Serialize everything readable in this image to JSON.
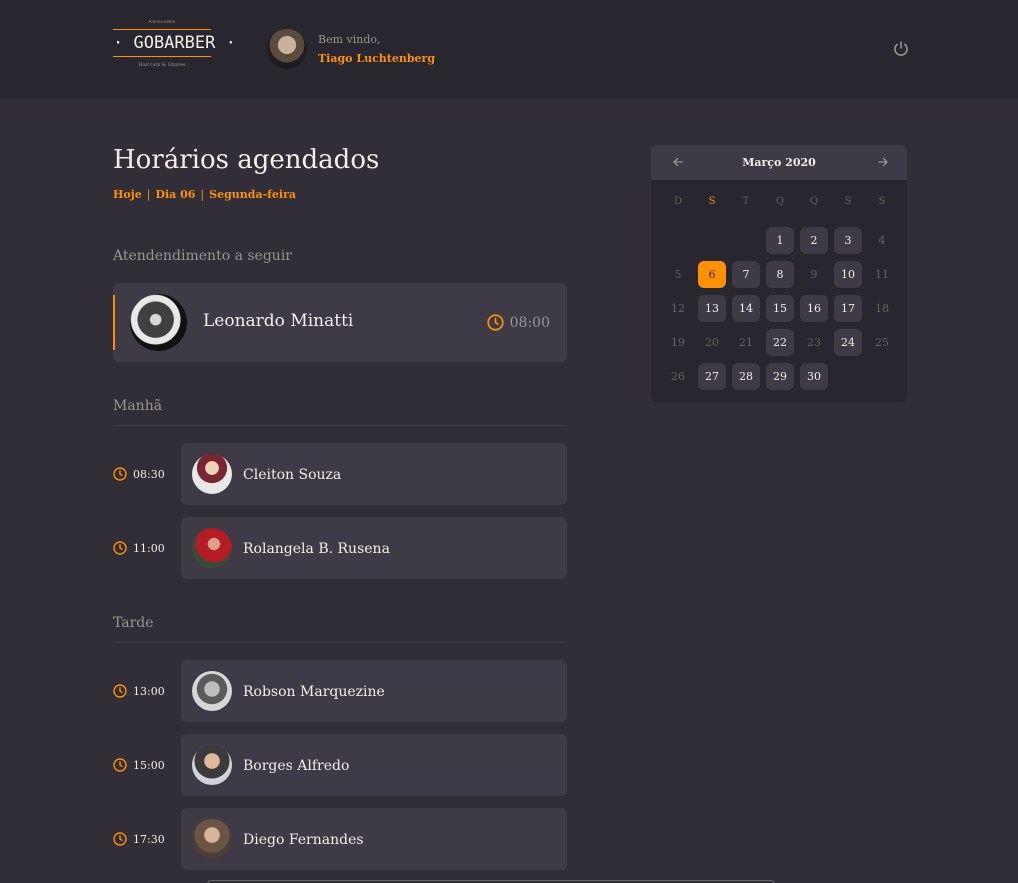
{
  "header": {
    "logo": {
      "top_text": "Awesome",
      "mark": "· GOBARBER ·",
      "bottom_text": "Haircuts & Shaves"
    },
    "welcome": "Bem vindo,",
    "user_name": "Tiago Luchtenberg",
    "power_icon": "power-icon"
  },
  "schedule": {
    "title": "Horários agendados",
    "subtitle": {
      "today": "Hoje",
      "sep": "|",
      "day": "Dia 06",
      "weekday": "Segunda-feira"
    },
    "next": {
      "label": "Atendendimento a seguir",
      "name": "Leonardo Minatti",
      "time": "08:00"
    },
    "morning": {
      "label": "Manhã",
      "items": [
        {
          "time": "08:30",
          "name": "Cleiton Souza"
        },
        {
          "time": "11:00",
          "name": "Rolangela B. Rusena"
        }
      ]
    },
    "afternoon": {
      "label": "Tarde",
      "items": [
        {
          "time": "13:00",
          "name": "Robson Marquezine"
        },
        {
          "time": "15:00",
          "name": "Borges Alfredo"
        },
        {
          "time": "17:30",
          "name": "Diego Fernandes"
        }
      ]
    }
  },
  "calendar": {
    "month_label": "Março 2020",
    "weekdays": [
      "D",
      "S",
      "T",
      "Q",
      "Q",
      "S",
      "S"
    ],
    "active_weekday_index": 1,
    "selected_day": 6,
    "weeks": [
      [
        null,
        null,
        null,
        1,
        2,
        3,
        4
      ],
      [
        5,
        6,
        7,
        8,
        9,
        10,
        11
      ],
      [
        12,
        13,
        14,
        15,
        16,
        17,
        18
      ],
      [
        19,
        20,
        21,
        22,
        23,
        24,
        25
      ],
      [
        26,
        27,
        28,
        29,
        30,
        null,
        null
      ]
    ],
    "available_days": [
      1,
      2,
      3,
      6,
      7,
      8,
      10,
      13,
      14,
      15,
      16,
      17,
      22,
      24,
      27,
      28,
      29,
      30
    ]
  },
  "colors": {
    "accent": "#ff9000",
    "background": "#312e38",
    "card": "#3e3b47",
    "header": "#28262e",
    "muted": "#999591"
  }
}
